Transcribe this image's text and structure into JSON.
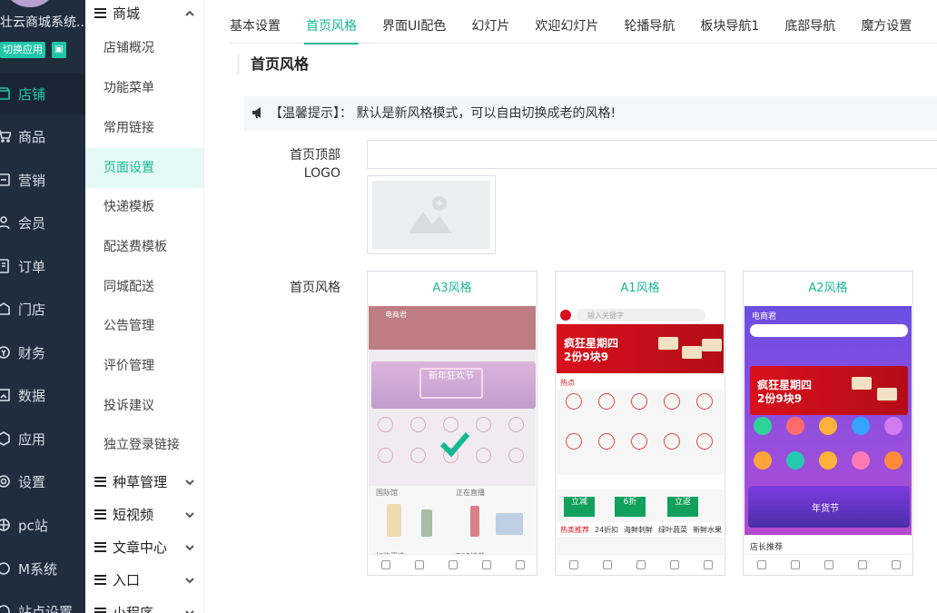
{
  "sidebar": {
    "brand": "壮云商城系统...",
    "switch_label": "切换应用",
    "items": [
      {
        "label": "店铺",
        "icon": "shop-icon",
        "active": true
      },
      {
        "label": "商品",
        "icon": "cart-icon"
      },
      {
        "label": "营销",
        "icon": "marketing-icon"
      },
      {
        "label": "会员",
        "icon": "member-icon"
      },
      {
        "label": "订单",
        "icon": "order-icon"
      },
      {
        "label": "门店",
        "icon": "store-icon"
      },
      {
        "label": "财务",
        "icon": "finance-icon"
      },
      {
        "label": "数据",
        "icon": "data-icon"
      },
      {
        "label": "应用",
        "icon": "app-icon"
      },
      {
        "label": "设置",
        "icon": "settings-icon"
      },
      {
        "label": "pc站",
        "icon": "pc-icon"
      },
      {
        "label": "M系统",
        "icon": "m-system-icon"
      },
      {
        "label": "站点设置",
        "icon": "site-settings-icon"
      }
    ]
  },
  "subnav": {
    "groups": [
      {
        "label": "商城",
        "expanded": true
      },
      {
        "label": "种草管理"
      },
      {
        "label": "短视频"
      },
      {
        "label": "文章中心"
      },
      {
        "label": "入口"
      },
      {
        "label": "小程序"
      }
    ],
    "items": [
      {
        "label": "店铺概况"
      },
      {
        "label": "功能菜单"
      },
      {
        "label": "常用链接"
      },
      {
        "label": "页面设置",
        "active": true
      },
      {
        "label": "快递模板"
      },
      {
        "label": "配送费模板"
      },
      {
        "label": "同城配送"
      },
      {
        "label": "公告管理"
      },
      {
        "label": "评价管理"
      },
      {
        "label": "投诉建议"
      },
      {
        "label": "独立登录链接"
      }
    ]
  },
  "tabs": [
    {
      "label": "基本设置"
    },
    {
      "label": "首页风格",
      "active": true
    },
    {
      "label": "界面UI配色"
    },
    {
      "label": "幻灯片"
    },
    {
      "label": "欢迎幻灯片"
    },
    {
      "label": "轮播导航"
    },
    {
      "label": "板块导航1"
    },
    {
      "label": "底部导航"
    },
    {
      "label": "魔方设置"
    }
  ],
  "section": {
    "title": "首页风格"
  },
  "tip": {
    "text": "【温馨提示】：  默认是新风格模式，可以自由切换成老的风格!"
  },
  "form": {
    "logo_label_1": "首页顶部",
    "logo_label_2": "LOGO",
    "logo_value": "",
    "style_label": "首页风格"
  },
  "styles": [
    {
      "name": "A3风格",
      "selected": true,
      "header": "电商君",
      "banner": "新年狂欢节",
      "sections": [
        "国际馆",
        "正在直播",
        "好物严选",
        "TOP榜单"
      ]
    },
    {
      "name": "A1风格",
      "search": "输入关键字",
      "banner_line1": "疯狂星期四",
      "banner_line2": "2份9块9",
      "hot": "热点",
      "promo": [
        "立减",
        "6折",
        "立返"
      ],
      "tabs": [
        "热卖推荐",
        "24折扣",
        "海鲜刺鲜",
        "绿叶蔬菜",
        "新鲜水果"
      ]
    },
    {
      "name": "A2风格",
      "header": "电商君",
      "banner_line1": "疯狂星期四",
      "banner_line2": "2份9块9",
      "fest": "年货节",
      "bottom": "店长推荐"
    }
  ],
  "colors": {
    "accent": "#16b894",
    "sidebar_bg": "#1f2d3d",
    "sub_active_bg": "#e6faf5"
  }
}
